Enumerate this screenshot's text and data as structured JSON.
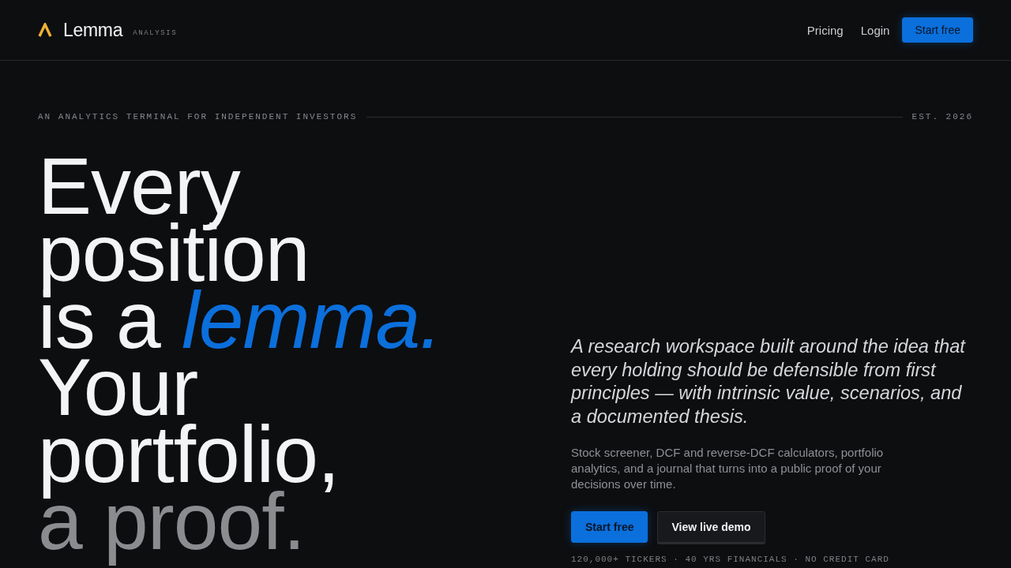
{
  "header": {
    "logo": {
      "name": "Lemma",
      "tag": "ANALYSIS"
    },
    "nav": [
      {
        "label": "Pricing",
        "kind": "link"
      },
      {
        "label": "Login",
        "kind": "link"
      },
      {
        "label": "Start free",
        "kind": "primary"
      }
    ]
  },
  "hero": {
    "eyebrow": "AN ANALYTICS TERMINAL FOR INDEPENDENT INVESTORS",
    "established": "EST. 2026",
    "headline": [
      {
        "segments": [
          {
            "text": "Every",
            "kind": "plain"
          }
        ]
      },
      {
        "segments": [
          {
            "text": "position",
            "kind": "plain"
          }
        ]
      },
      {
        "segments": [
          {
            "text": "is a ",
            "kind": "plain"
          },
          {
            "text": "lemma.",
            "kind": "accent"
          }
        ]
      },
      {
        "segments": [
          {
            "text": "Your",
            "kind": "plain"
          }
        ]
      },
      {
        "segments": [
          {
            "text": "portfolio,",
            "kind": "plain"
          }
        ]
      },
      {
        "segments": [
          {
            "text": "a proof.",
            "kind": "muted"
          }
        ]
      }
    ],
    "lead": "A research workspace built around the idea that every holding should be defensible from first principles — with intrinsic value, scenarios, and a documented thesis.",
    "description": "Stock screener, DCF and reverse-DCF calculators, portfolio analytics, and a journal that turns into a public proof of your decisions over time.",
    "buttons": [
      {
        "label": "Start free",
        "kind": "primary"
      },
      {
        "label": "View live demo",
        "kind": "secondary"
      }
    ],
    "stats": "120,000+ TICKERS · 40 YRS FINANCIALS · NO CREDIT CARD"
  }
}
